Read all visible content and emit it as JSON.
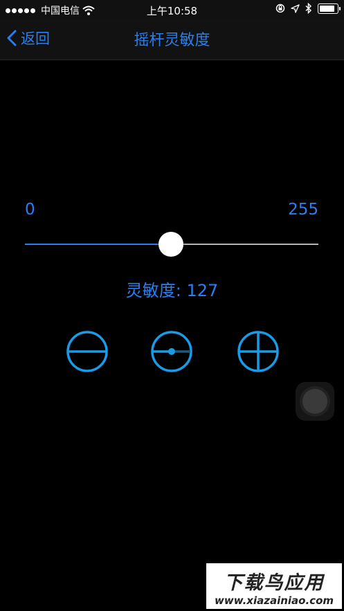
{
  "status_bar": {
    "carrier": "中国电信",
    "time": "上午10:58"
  },
  "nav": {
    "back_label": "返回",
    "title": "摇杆灵敏度"
  },
  "slider": {
    "min_label": "0",
    "max_label": "255",
    "min": 0,
    "max": 255,
    "value": 127
  },
  "readout": {
    "text": "灵敏度: 127"
  },
  "controls": {
    "icons": [
      "minus-circle-icon",
      "reset-circle-icon",
      "plus-circle-icon"
    ]
  },
  "colors": {
    "accent": "#2a7ff0",
    "control_blue": "#1a9be8",
    "background": "#000000",
    "track": "#b5b5b5"
  },
  "watermark": {
    "line1": "下载鸟应用",
    "line2": "www.xiazainiao.com"
  }
}
